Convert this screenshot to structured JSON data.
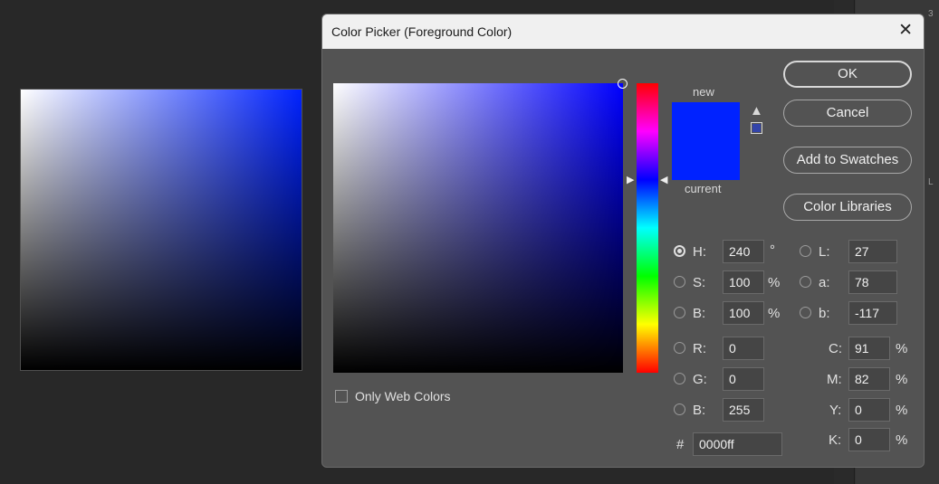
{
  "dialog": {
    "title": "Color Picker (Foreground Color)",
    "close_glyph": "✕",
    "new_label": "new",
    "current_label": "current",
    "new_color": "#0022ff",
    "current_color": "#0022ff",
    "websafe_color": "#3344aa",
    "warning_glyph": "▲"
  },
  "buttons": {
    "ok": "OK",
    "cancel": "Cancel",
    "add_swatches": "Add to Swatches",
    "color_libraries": "Color Libraries"
  },
  "hsb": {
    "h_label": "H:",
    "h_value": "240",
    "h_unit": "°",
    "s_label": "S:",
    "s_value": "100",
    "s_unit": "%",
    "b_label": "B:",
    "b_value": "100",
    "b_unit": "%"
  },
  "lab": {
    "l_label": "L:",
    "l_value": "27",
    "a_label": "a:",
    "a_value": "78",
    "b_label": "b:",
    "b_value": "-117"
  },
  "rgb": {
    "r_label": "R:",
    "r_value": "0",
    "g_label": "G:",
    "g_value": "0",
    "b_label": "B:",
    "b_value": "255"
  },
  "cmyk": {
    "c_label": "C:",
    "c_value": "91",
    "c_unit": "%",
    "m_label": "M:",
    "m_value": "82",
    "m_unit": "%",
    "y_label": "Y:",
    "y_value": "0",
    "y_unit": "%",
    "k_label": "K:",
    "k_value": "0",
    "k_unit": "%"
  },
  "hex": {
    "label": "#",
    "value": "0000ff"
  },
  "web_colors": {
    "label": "Only Web Colors",
    "checked": false
  },
  "selected_mode": "H",
  "hue_arrows": {
    "left": "▶",
    "right": "◀"
  },
  "app": {
    "edge_tick_1": "3",
    "edge_tick_2": "L"
  }
}
